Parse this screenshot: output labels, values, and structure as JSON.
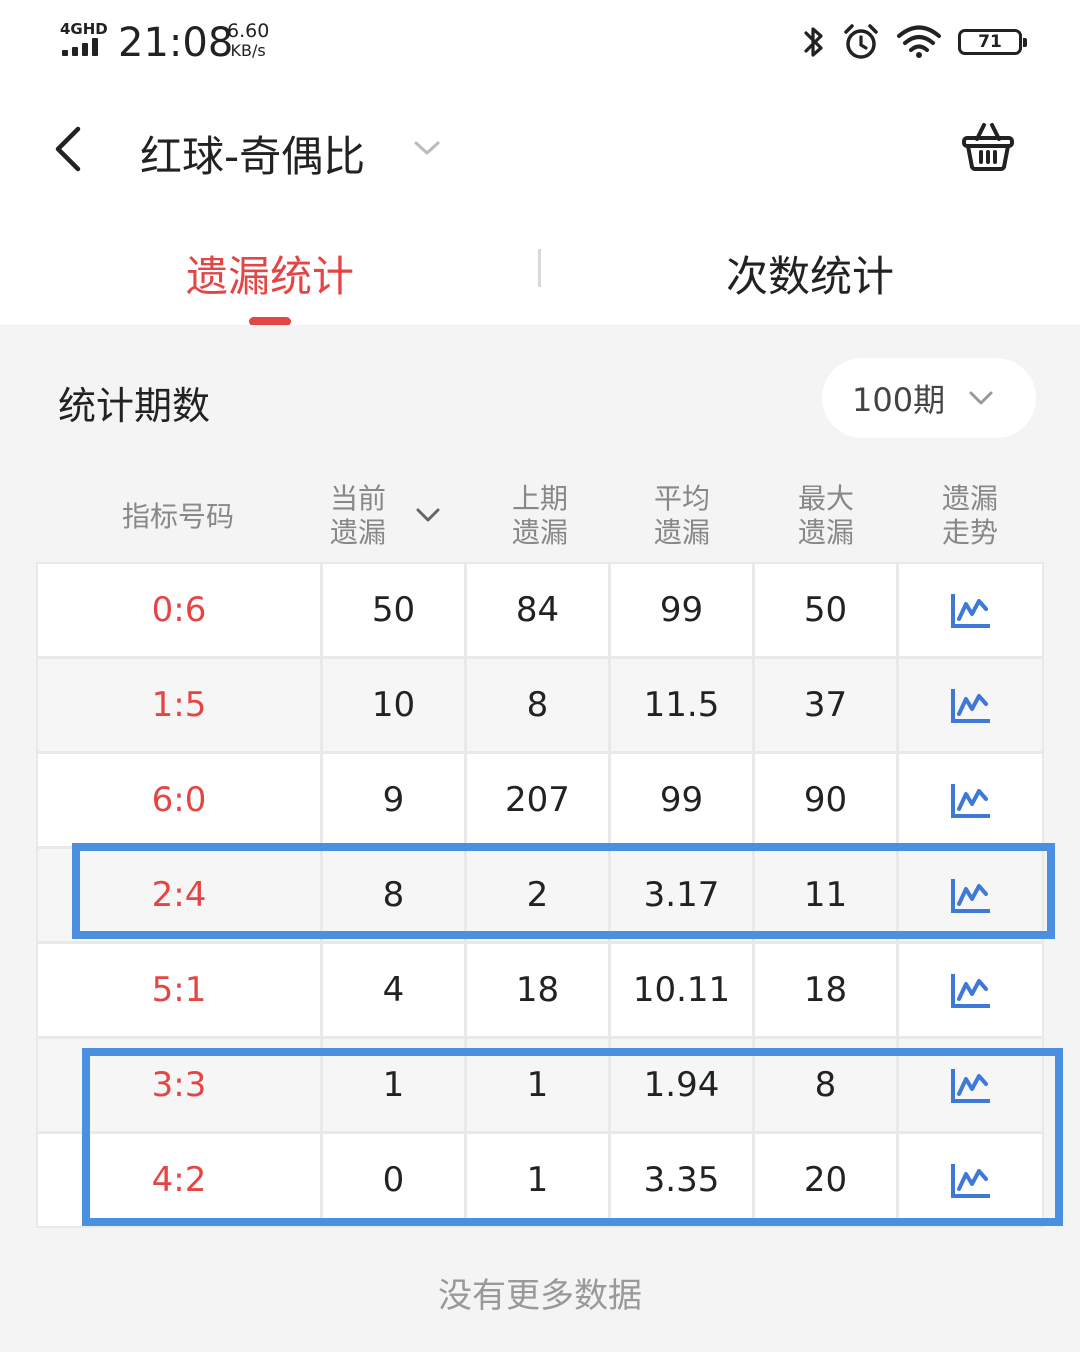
{
  "status_bar": {
    "network": "4GHD",
    "time": "21:08",
    "speed_value": "6.60",
    "speed_unit": "KB/s",
    "battery": "71",
    "icons": [
      "bluetooth-icon",
      "alarm-icon",
      "wifi-icon",
      "battery-icon"
    ]
  },
  "header": {
    "title": "红球-奇偶比",
    "back_icon": "back-arrow-icon",
    "dropdown_icon": "chevron-down-icon",
    "basket_icon": "basket-icon"
  },
  "tabs": [
    {
      "label": "遗漏统计",
      "active": true
    },
    {
      "label": "次数统计",
      "active": false
    }
  ],
  "period": {
    "label": "统计期数",
    "value": "100期"
  },
  "table": {
    "headers": [
      {
        "line1": "指标号码",
        "line2": ""
      },
      {
        "line1": "当前",
        "line2": "遗漏"
      },
      {
        "line1": "上期",
        "line2": "遗漏"
      },
      {
        "line1": "平均",
        "line2": "遗漏"
      },
      {
        "line1": "最大",
        "line2": "遗漏"
      },
      {
        "line1": "遗漏",
        "line2": "走势"
      }
    ],
    "rows": [
      {
        "ratio": "0:6",
        "current": "50",
        "previous": "84",
        "average": "99",
        "max": "50"
      },
      {
        "ratio": "1:5",
        "current": "10",
        "previous": "8",
        "average": "11.5",
        "max": "37"
      },
      {
        "ratio": "6:0",
        "current": "9",
        "previous": "207",
        "average": "99",
        "max": "90"
      },
      {
        "ratio": "2:4",
        "current": "8",
        "previous": "2",
        "average": "3.17",
        "max": "11"
      },
      {
        "ratio": "5:1",
        "current": "4",
        "previous": "18",
        "average": "10.11",
        "max": "18"
      },
      {
        "ratio": "3:3",
        "current": "1",
        "previous": "1",
        "average": "1.94",
        "max": "8"
      },
      {
        "ratio": "4:2",
        "current": "0",
        "previous": "1",
        "average": "3.35",
        "max": "20"
      }
    ],
    "trend_icon": "trend-chart-icon"
  },
  "footer": {
    "no_more": "没有更多数据"
  },
  "colors": {
    "accent_red": "#e44545",
    "trend_blue": "#3f79d8",
    "highlight_blue": "#4a8fe0"
  }
}
